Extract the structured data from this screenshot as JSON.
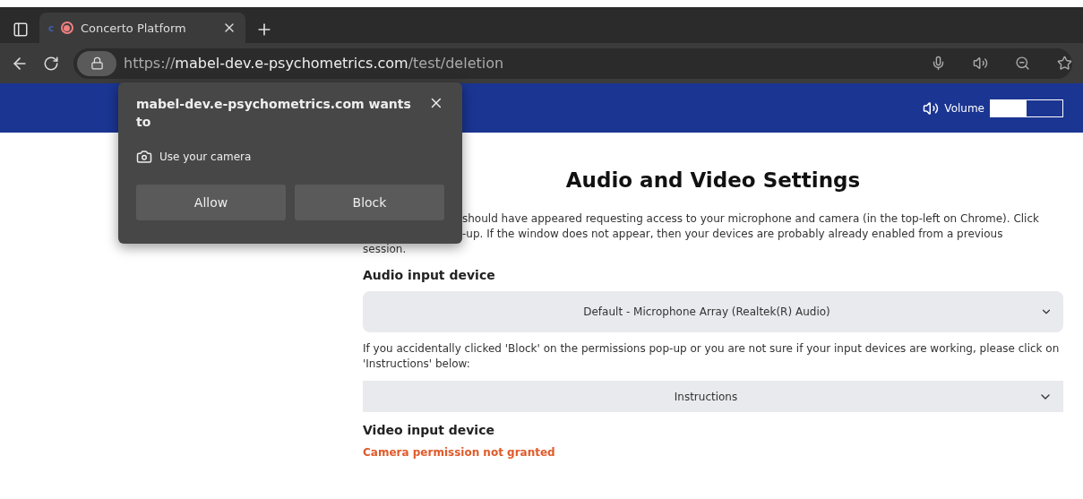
{
  "browser": {
    "tab": {
      "title": "Concerto Platform",
      "favicon": "c",
      "recording": true
    },
    "address": {
      "scheme": "https://",
      "host": "mabel-dev.e-psychometrics.com",
      "path": "/test/deletion"
    }
  },
  "banner": {
    "volume_label": "Volume",
    "volume": {
      "level": 0.5
    }
  },
  "permission_popup": {
    "title": "mabel-dev.e-psychometrics.com wants to",
    "permission": "Use your camera",
    "buttons": [
      "Allow",
      "Block"
    ]
  },
  "page": {
    "title": "Audio and Video Settings",
    "intro_lines": [
      {
        "kind": "covered",
        "text": "should have appeared requesting access to your microphone and camera (in the top-left on Chrome). Click"
      },
      {
        "kind": "covered",
        "text": "-up. If the window does not appear, then your devices are probably already enabled from a previous"
      },
      {
        "kind": "full",
        "text": "session."
      }
    ],
    "audio_heading": "Audio input device",
    "audio_select": {
      "value": "Default - Microphone Array (Realtek(R) Audio)"
    },
    "help_text": "If you accidentally clicked 'Block' on the permissions pop-up or you are not sure if your input devices are working, please click on 'Instructions' below:",
    "instructions": {
      "label": "Instructions",
      "expanded": false
    },
    "video_heading": "Video input device",
    "video_error": "Camera permission not granted"
  }
}
